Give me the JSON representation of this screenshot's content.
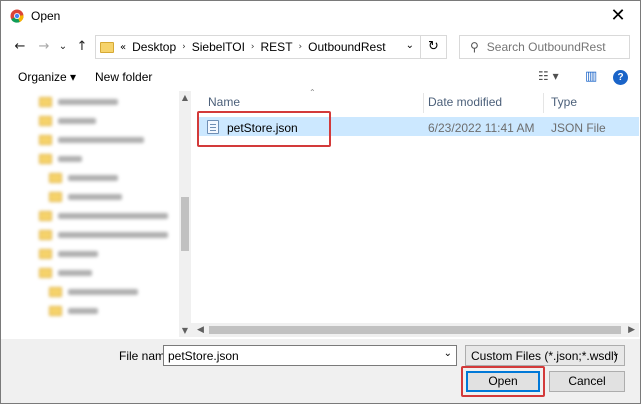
{
  "window": {
    "title": "Open",
    "close_glyph": "✕",
    "app_icon": "chrome-icon"
  },
  "nav": {
    "back_glyph": "←",
    "forward_glyph": "→",
    "recent_glyph": "⌄",
    "up_glyph": "↑",
    "overflow": "«",
    "breadcrumbs": [
      "Desktop",
      "SiebelTOI",
      "REST",
      "OutboundRest"
    ],
    "crumb_sep": "›",
    "refresh_glyph": "↻",
    "search_placeholder": "Search OutboundRest"
  },
  "toolbar": {
    "organize_label": "Organize ▾",
    "new_folder_label": "New folder",
    "view_glyph": "☷ ▾",
    "preview_glyph": "▥",
    "help_glyph": "?"
  },
  "file_list": {
    "columns": [
      "Name",
      "Date modified",
      "Type"
    ],
    "rows": [
      {
        "name": "petStore.json",
        "date_modified": "6/23/2022 11:41 AM",
        "type": "JSON File"
      }
    ]
  },
  "bottom": {
    "file_name_label": "File name:",
    "file_name_value": "petStore.json",
    "file_type_value": "Custom Files (*.json;*.wsdl)",
    "open_label": "Open",
    "cancel_label": "Cancel"
  },
  "colors": {
    "selection": "#cce8ff",
    "highlight_box": "#d33a3a",
    "focus_border": "#0078d7"
  }
}
